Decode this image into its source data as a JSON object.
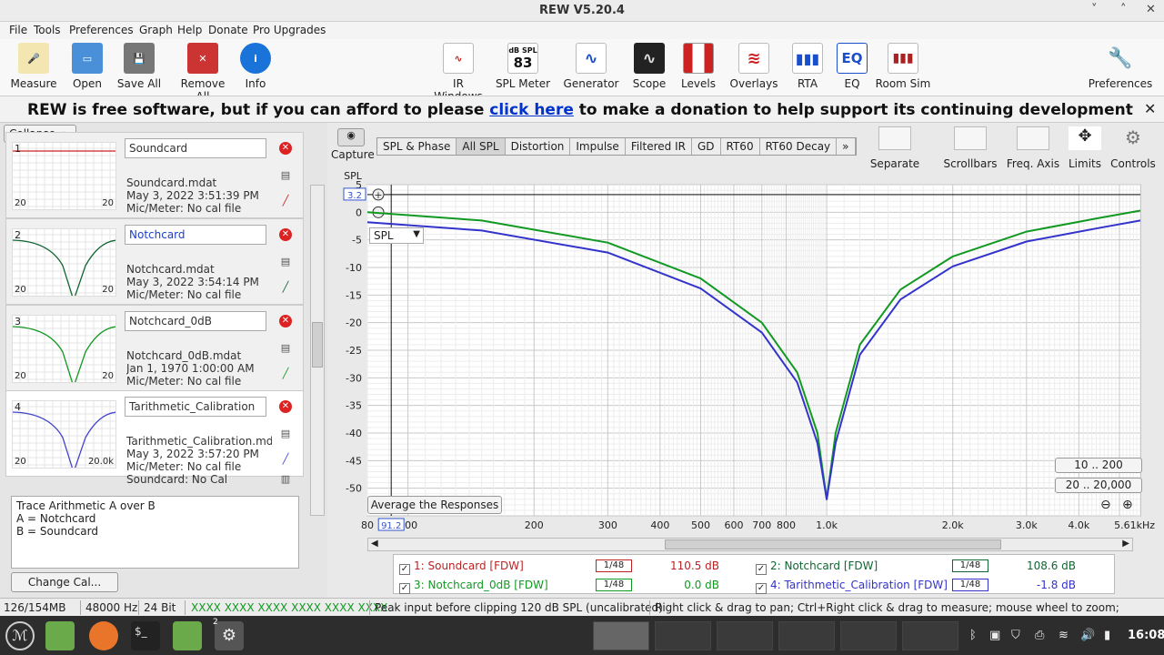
{
  "window": {
    "title": "REW V5.20.4"
  },
  "menu": [
    "File",
    "Tools",
    "Preferences",
    "Graph",
    "Help",
    "Donate",
    "Pro Upgrades"
  ],
  "toolbar": {
    "left": [
      {
        "label": "Measure",
        "icon": "microphone-icon"
      },
      {
        "label": "Open",
        "icon": "folder-icon"
      },
      {
        "label": "Save All",
        "icon": "save-icon"
      },
      {
        "label": "Remove All",
        "icon": "remove-all-icon"
      },
      {
        "label": "Info",
        "icon": "info-icon"
      }
    ],
    "center": [
      {
        "label": "IR Windows",
        "icon": "ir-windows-icon"
      },
      {
        "label": "SPL Meter",
        "icon": "spl-meter-icon",
        "badge_top": "dB SPL",
        "badge_value": "83"
      },
      {
        "label": "Generator",
        "icon": "generator-icon"
      },
      {
        "label": "Scope",
        "icon": "scope-icon"
      },
      {
        "label": "Levels",
        "icon": "levels-icon"
      },
      {
        "label": "Overlays",
        "icon": "overlays-icon"
      },
      {
        "label": "RTA",
        "icon": "rta-icon"
      },
      {
        "label": "EQ",
        "icon": "eq-icon"
      },
      {
        "label": "Room Sim",
        "icon": "room-sim-icon"
      }
    ],
    "right": [
      {
        "label": "Preferences",
        "icon": "wrench-icon"
      }
    ]
  },
  "donate": {
    "before": "REW is free software, but if you can afford to please ",
    "link": "click here",
    "after": " to make a donation to help support its continuing development"
  },
  "left": {
    "collapse_label": "Collapse",
    "measurements": [
      {
        "num": "1",
        "name": "Soundcard",
        "file": "Soundcard.mdat",
        "date": "May 3, 2022 3:51:39 PM",
        "mic": "Mic/Meter: No cal file",
        "extra": "",
        "ax_a": "20",
        "ax_b": "20",
        "color": "#cc2222",
        "name_color": "#333"
      },
      {
        "num": "2",
        "name": "Notchcard",
        "file": "Notchcard.mdat",
        "date": "May 3, 2022 3:54:14 PM",
        "mic": "Mic/Meter: No cal file",
        "extra": "",
        "ax_a": "20",
        "ax_b": "20",
        "color": "#116633",
        "name_color": "#1a3fcc"
      },
      {
        "num": "3",
        "name": "Notchcard_0dB",
        "file": "Notchcard_0dB.mdat",
        "date": "Jan 1, 1970 1:00:00 AM",
        "mic": "Mic/Meter: No cal file",
        "extra": "",
        "ax_a": "20",
        "ax_b": "20",
        "color": "#119922",
        "name_color": "#333"
      },
      {
        "num": "4",
        "name": "Tarithmetic_Calibration",
        "file": "Tarithmetic_Calibration.mdat",
        "date": "May 3, 2022 3:57:20 PM",
        "mic": "Mic/Meter: No cal file",
        "extra": "Soundcard: No Cal",
        "ax_a": "20",
        "ax_b": "20.0k",
        "color": "#4444cc",
        "name_color": "#333"
      }
    ],
    "notes": [
      "Trace Arithmetic A over B",
      "A = Notchcard",
      "B = Soundcard"
    ],
    "change_cal": "Change Cal..."
  },
  "graph": {
    "capture_label": "Capture",
    "tabs": [
      "SPL & Phase",
      "All SPL",
      "Distortion",
      "Impulse",
      "Filtered IR",
      "GD",
      "RT60",
      "RT60 Decay",
      "»"
    ],
    "active_tab": "All SPL",
    "right_tools": [
      {
        "label": "Separate",
        "icon": "separate-icon"
      },
      {
        "label": "Scrollbars",
        "icon": "scrollbars-icon"
      },
      {
        "label": "Freq. Axis",
        "icon": "freq-axis-icon"
      },
      {
        "label": "Limits",
        "icon": "limits-icon"
      },
      {
        "label": "Controls",
        "icon": "controls-icon"
      }
    ],
    "y_unit": "SPL",
    "cursor_y": "3.2",
    "cursor_x": "91.2",
    "dropdown": "SPL",
    "avg_button": "Average the Responses",
    "range_buttons": [
      "10 .. 200",
      "20 .. 20,000"
    ],
    "x_unit": "kHz",
    "legend": [
      {
        "label": "1: Soundcard [FDW]",
        "smooth": "1/48",
        "value": "110.5 dB",
        "color": "#bb2222"
      },
      {
        "label": "2: Notchcard [FDW]",
        "smooth": "1/48",
        "value": "108.6 dB",
        "color": "#116633"
      },
      {
        "label": "3: Notchcard_0dB [FDW]",
        "smooth": "1/48",
        "value": "0.0 dB",
        "color": "#119922"
      },
      {
        "label": "4: Tarithmetic_Calibration [FDW]",
        "smooth": "1/48",
        "value": "-1.8 dB",
        "color": "#3333cc"
      }
    ]
  },
  "chart_data": {
    "type": "line",
    "xlabel": "",
    "ylabel": "SPL",
    "x_scale": "log",
    "xlim": [
      80,
      5610
    ],
    "ylim": [
      -55,
      5
    ],
    "x_ticks": [
      "80",
      "100",
      "200",
      "300",
      "400",
      "500",
      "600",
      "700",
      "800",
      "1.0k",
      "2.0k",
      "3.0k",
      "4.0k",
      "5.61kHz"
    ],
    "y_ticks": [
      "5",
      "0",
      "-5",
      "-10",
      "-15",
      "-20",
      "-25",
      "-30",
      "-35",
      "-40",
      "-45",
      "-50"
    ],
    "grid": true,
    "series": [
      {
        "name": "3: Notchcard_0dB [FDW]",
        "color": "#119922",
        "x": [
          80,
          150,
          300,
          500,
          700,
          850,
          950,
          1000,
          1050,
          1200,
          1500,
          2000,
          3000,
          4500,
          5610
        ],
        "y": [
          0,
          -1.5,
          -5.5,
          -12,
          -20,
          -29,
          -40,
          -52,
          -40,
          -24,
          -14,
          -8,
          -3.5,
          -1,
          0.3
        ]
      },
      {
        "name": "4: Tarithmetic_Calibration [FDW]",
        "color": "#3333cc",
        "x": [
          80,
          150,
          300,
          500,
          700,
          850,
          950,
          1000,
          1050,
          1200,
          1500,
          2000,
          3000,
          4500,
          5610
        ],
        "y": [
          -1.8,
          -3.3,
          -7.3,
          -13.8,
          -21.8,
          -30.8,
          -41.8,
          -52,
          -41.8,
          -25.8,
          -15.8,
          -9.8,
          -5.3,
          -2.8,
          -1.5
        ]
      }
    ]
  },
  "status": {
    "memory": "126/154MB",
    "rate": "48000 Hz",
    "bits": "24 Bit",
    "xxxx": "XXXX XXXX  XXXX XXXX  XXXX XXXX",
    "peak": "Peak input before clipping 120 dB SPL (uncalibrated)",
    "hint": "Right click & drag to pan; Ctrl+Right click & drag to measure; mouse wheel to zoom;"
  },
  "taskbar": {
    "clock": "16:08",
    "badge": "2"
  }
}
